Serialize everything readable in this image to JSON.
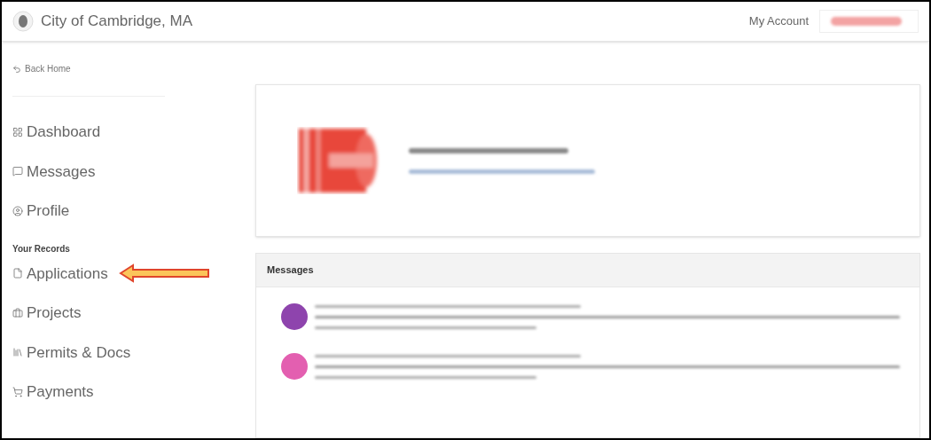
{
  "header": {
    "title": "City of Cambridge, MA",
    "account_label": "My Account"
  },
  "sidebar": {
    "back_link": "Back Home",
    "items": [
      {
        "label": "Dashboard",
        "kind": "dashboard",
        "arrow": false
      },
      {
        "label": "Messages",
        "kind": "messages",
        "arrow": false
      },
      {
        "label": "Profile",
        "kind": "profile",
        "arrow": false
      }
    ],
    "section_title": "Your Records",
    "record_items": [
      {
        "label": "Applications",
        "kind": "applications",
        "arrow": true
      },
      {
        "label": "Projects",
        "kind": "projects",
        "arrow": false
      },
      {
        "label": "Permits & Docs",
        "kind": "permits",
        "arrow": false
      },
      {
        "label": "Payments",
        "kind": "payments",
        "arrow": false
      }
    ]
  },
  "messages": {
    "title": "Messages",
    "items": [
      {
        "color": "#8e44ad"
      },
      {
        "color": "#e35fb0"
      }
    ]
  }
}
